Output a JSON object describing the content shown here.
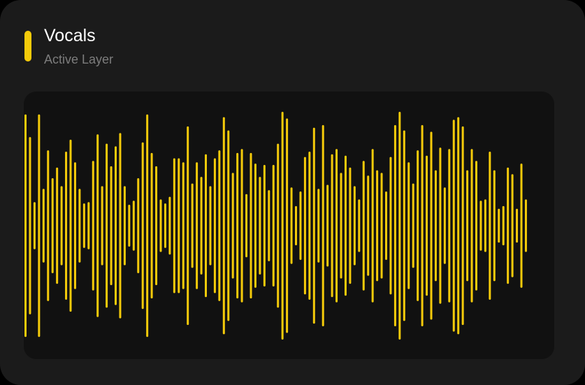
{
  "layer": {
    "name": "Vocals",
    "status": "Active Layer"
  },
  "colors": {
    "accent": "#f5cb0a",
    "card_background": "#1b1b1b",
    "waveform_background": "#111111",
    "title": "#ffffff",
    "subtitle": "#7d7d7d"
  },
  "waveform": {
    "amplitudes": [
      0.83,
      0.66,
      0.17,
      0.83,
      0.27,
      0.56,
      0.35,
      0.43,
      0.29,
      0.55,
      0.64,
      0.47,
      0.27,
      0.16,
      0.17,
      0.48,
      0.68,
      0.29,
      0.61,
      0.44,
      0.59,
      0.69,
      0.29,
      0.15,
      0.18,
      0.35,
      0.62,
      0.83,
      0.54,
      0.44,
      0.19,
      0.16,
      0.21,
      0.5,
      0.5,
      0.47,
      0.74,
      0.31,
      0.47,
      0.36,
      0.53,
      0.29,
      0.5,
      0.56,
      0.81,
      0.71,
      0.39,
      0.54,
      0.57,
      0.23,
      0.54,
      0.46,
      0.36,
      0.45,
      0.26,
      0.45,
      0.61,
      0.85,
      0.8,
      0.28,
      0.14,
      0.25,
      0.51,
      0.55,
      0.73,
      0.27,
      0.75,
      0.3,
      0.53,
      0.57,
      0.39,
      0.52,
      0.43,
      0.29,
      0.19,
      0.48,
      0.37,
      0.57,
      0.41,
      0.39,
      0.25,
      0.51,
      0.75,
      0.85,
      0.71,
      0.47,
      0.31,
      0.56,
      0.75,
      0.52,
      0.7,
      0.41,
      0.58,
      0.28,
      0.57,
      0.79,
      0.81,
      0.74,
      0.41,
      0.57,
      0.48,
      0.18,
      0.19,
      0.55,
      0.41,
      0.12,
      0.14,
      0.43,
      0.38,
      0.12,
      0.46,
      0.19
    ]
  }
}
